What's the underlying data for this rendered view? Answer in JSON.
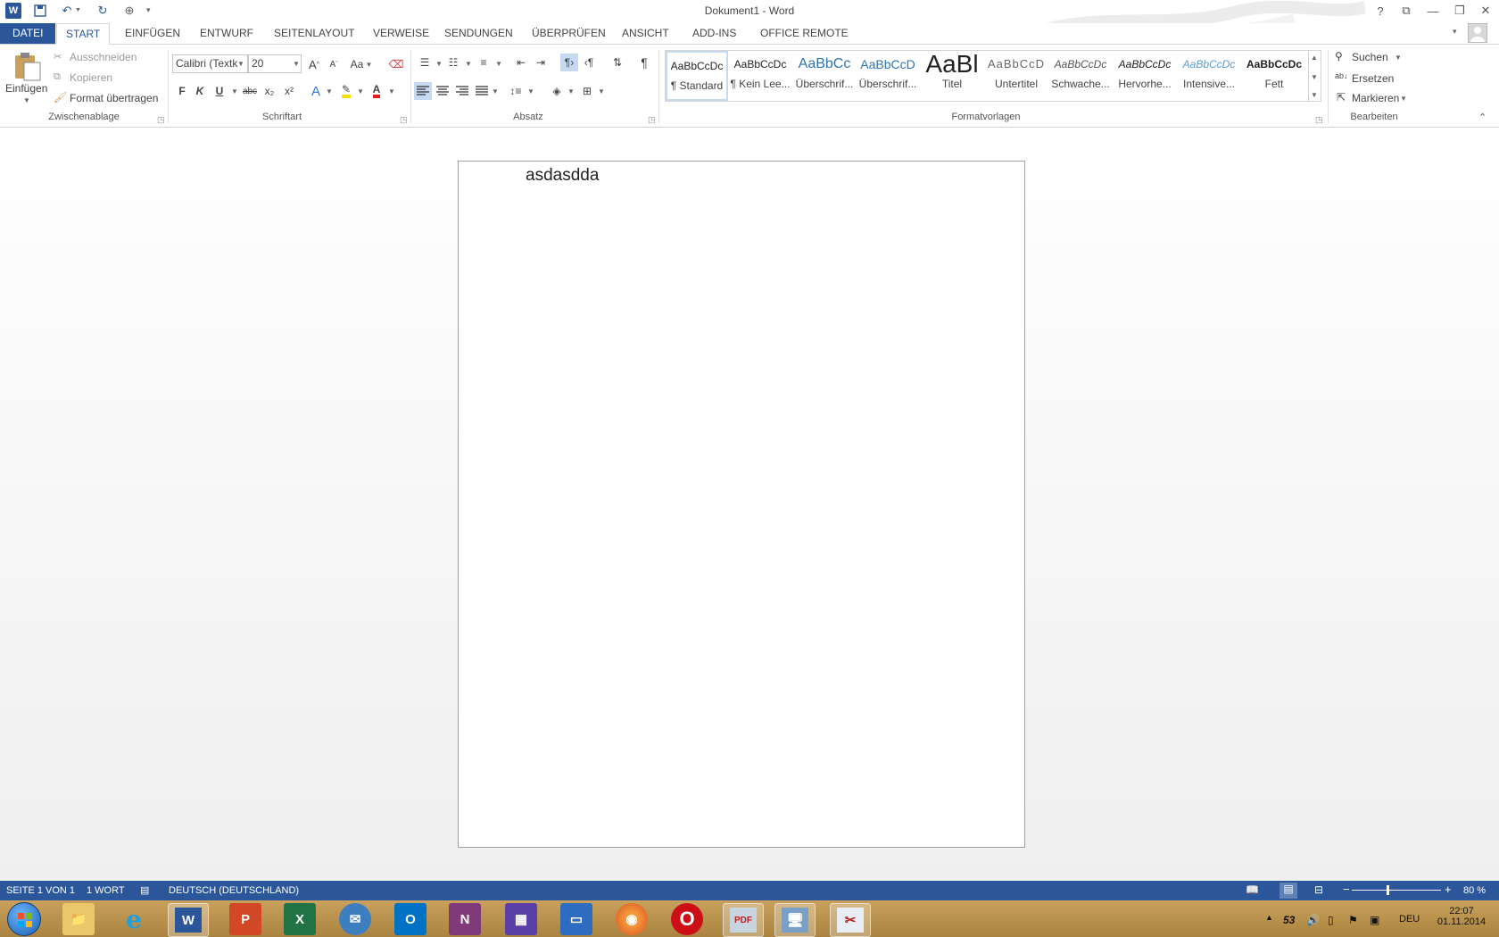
{
  "window": {
    "title": "Dokument1 - Word"
  },
  "qat": {
    "word_icon": "word-logo-icon",
    "save_icon": "save-icon",
    "undo_icon": "undo-icon",
    "redo_icon": "redo-icon",
    "touch_icon": "touch-mode-icon",
    "customize_icon": "customize-qat-icon"
  },
  "tabs": [
    "DATEI",
    "START",
    "EINFÜGEN",
    "ENTWURF",
    "SEITENLAYOUT",
    "VERWEISE",
    "SENDUNGEN",
    "ÜBERPRÜFEN",
    "ANSICHT",
    "ADD-INS",
    "OFFICE REMOTE"
  ],
  "clipboard": {
    "paste": "Einfügen",
    "cut": "Ausschneiden",
    "copy": "Kopieren",
    "format_painter": "Format übertragen",
    "group": "Zwischenablage"
  },
  "font": {
    "name": "Calibri (Textk",
    "size": "20",
    "bold": "F",
    "italic": "K",
    "underline": "U",
    "strike": "abc",
    "sub": "x₂",
    "sup": "x²",
    "grow": "A",
    "shrink": "A",
    "case": "Aa",
    "group": "Schriftart"
  },
  "paragraph": {
    "group": "Absatz",
    "pilcrow": "¶"
  },
  "styles": {
    "group": "Formatvorlagen",
    "items": [
      {
        "sample": "AaBbCcDc",
        "name": "¶ Standard"
      },
      {
        "sample": "AaBbCcDc",
        "name": "¶ Kein Lee..."
      },
      {
        "sample": "AaBbCc",
        "name": "Überschrif..."
      },
      {
        "sample": "AaBbCcD",
        "name": "Überschrif..."
      },
      {
        "sample": "AaBl",
        "name": "Titel"
      },
      {
        "sample": "AaBbCcD",
        "name": "Untertitel"
      },
      {
        "sample": "AaBbCcDc",
        "name": "Schwache..."
      },
      {
        "sample": "AaBbCcDc",
        "name": "Hervorhe..."
      },
      {
        "sample": "AaBbCcDc",
        "name": "Intensive..."
      },
      {
        "sample": "AaBbCcDc",
        "name": "Fett"
      }
    ]
  },
  "editing": {
    "find": "Suchen",
    "replace": "Ersetzen",
    "select": "Markieren",
    "group": "Bearbeiten"
  },
  "document": {
    "text": "asdasdda"
  },
  "status": {
    "page": "SEITE 1 VON 1",
    "words": "1 WORT",
    "language": "DEUTSCH (DEUTSCHLAND)",
    "zoom": "80 %",
    "zoom_fraction": 0.4
  },
  "taskbar": {
    "apps": [
      {
        "name": "start-button",
        "glyph": ""
      },
      {
        "name": "explorer-icon",
        "glyph": ""
      },
      {
        "name": "internet-explorer-icon",
        "glyph": "e"
      },
      {
        "name": "word-taskbar-icon",
        "glyph": "W"
      },
      {
        "name": "powerpoint-icon",
        "glyph": "P"
      },
      {
        "name": "excel-icon",
        "glyph": "X"
      },
      {
        "name": "thunderbird-icon",
        "glyph": ""
      },
      {
        "name": "outlook-icon",
        "glyph": "O"
      },
      {
        "name": "onenote-icon",
        "glyph": "N"
      },
      {
        "name": "calendar-app-icon",
        "glyph": ""
      },
      {
        "name": "scanner-app-icon",
        "glyph": ""
      },
      {
        "name": "firefox-icon",
        "glyph": ""
      },
      {
        "name": "opera-icon",
        "glyph": "O"
      },
      {
        "name": "pdf-app-icon",
        "glyph": "PDF"
      },
      {
        "name": "remote-desktop-icon",
        "glyph": ""
      },
      {
        "name": "snipping-tool-icon",
        "glyph": ""
      }
    ],
    "tray_temp": "53",
    "language": "DEU",
    "time": "22:07",
    "date": "01.11.2014"
  },
  "colors": {
    "accent": "#2b579a",
    "taskbar": "#b8924c"
  }
}
